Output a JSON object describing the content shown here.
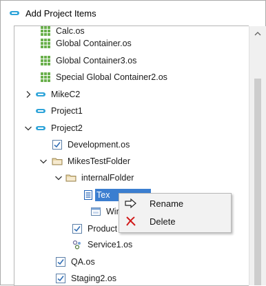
{
  "window": {
    "title": "Add Project Items"
  },
  "tree": {
    "items": [
      {
        "label": "Calc.os",
        "type": "container"
      },
      {
        "label": "Global Container.os",
        "type": "container"
      },
      {
        "label": "Global Container3.os",
        "type": "container"
      },
      {
        "label": "Special Global Container2.os",
        "type": "container"
      },
      {
        "label": "MikeC2",
        "type": "project",
        "expanded": false
      },
      {
        "label": "Project1",
        "type": "project"
      },
      {
        "label": "Project2",
        "type": "project",
        "expanded": true
      },
      {
        "label": "Development.os",
        "type": "check"
      },
      {
        "label": "MikesTestFolder",
        "type": "folder",
        "expanded": true
      },
      {
        "label": "internalFolder",
        "type": "folder",
        "expanded": true
      },
      {
        "label": "Tex",
        "type": "document",
        "selected": true
      },
      {
        "label": "Win",
        "type": "window"
      },
      {
        "label": "Product",
        "type": "check"
      },
      {
        "label": "Service1.os",
        "type": "service"
      },
      {
        "label": "QA.os",
        "type": "check"
      },
      {
        "label": "Staging2.os",
        "type": "check"
      }
    ]
  },
  "context_menu": {
    "items": [
      {
        "label": "Rename",
        "icon": "rename-icon"
      },
      {
        "label": "Delete",
        "icon": "delete-icon"
      }
    ]
  },
  "colors": {
    "accent": "#3b7ed0",
    "project_icon": "#2fa4d9",
    "container_icon": "#6ab04c",
    "delete_icon": "#d11a1a"
  }
}
